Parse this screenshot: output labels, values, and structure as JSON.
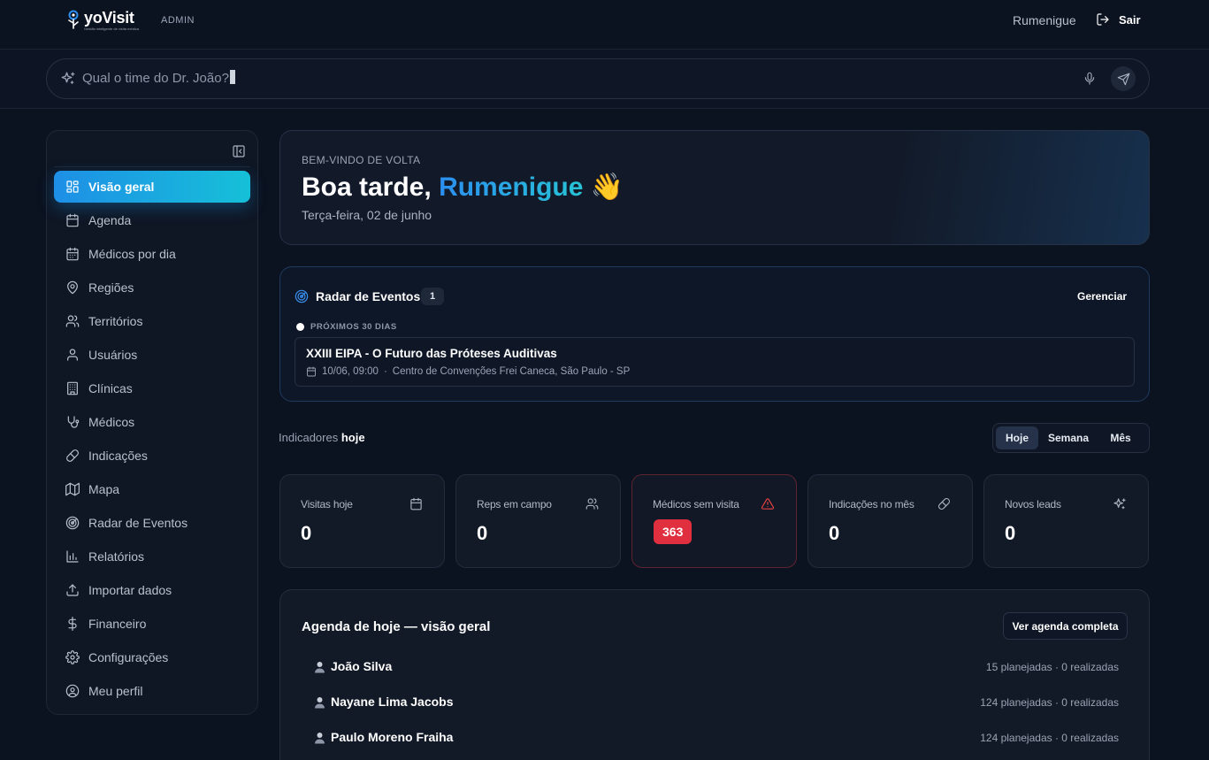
{
  "header": {
    "brand": "yoVisit",
    "tagline": "Gestão inteligente de visita médica",
    "role_badge": "ADMIN",
    "user_name": "Rumenigue",
    "logout_label": "Sair"
  },
  "search": {
    "placeholder": "Qual o time do Dr. João?"
  },
  "sidebar": {
    "items": [
      {
        "label": "Visão geral",
        "icon": "dashboard-icon",
        "active": true
      },
      {
        "label": "Agenda",
        "icon": "calendar-icon"
      },
      {
        "label": "Médicos por dia",
        "icon": "calendar-days-icon"
      },
      {
        "label": "Regiões",
        "icon": "map-pin-icon"
      },
      {
        "label": "Territórios",
        "icon": "users-icon"
      },
      {
        "label": "Usuários",
        "icon": "user-icon"
      },
      {
        "label": "Clínicas",
        "icon": "building-icon"
      },
      {
        "label": "Médicos",
        "icon": "stethoscope-icon"
      },
      {
        "label": "Indicações",
        "icon": "pill-icon"
      },
      {
        "label": "Mapa",
        "icon": "map-icon"
      },
      {
        "label": "Radar de Eventos",
        "icon": "radar-icon"
      },
      {
        "label": "Relatórios",
        "icon": "bar-chart-icon"
      },
      {
        "label": "Importar dados",
        "icon": "upload-icon"
      },
      {
        "label": "Financeiro",
        "icon": "dollar-icon"
      },
      {
        "label": "Configurações",
        "icon": "gear-icon"
      },
      {
        "label": "Meu perfil",
        "icon": "user-circle-icon"
      }
    ]
  },
  "welcome": {
    "kicker": "BEM-VINDO DE VOLTA",
    "greeting": "Boa tarde,",
    "name": "Rumenigue",
    "emoji": "👋",
    "date": "Terça-feira, 02 de junho"
  },
  "radar": {
    "title": "Radar de Eventos",
    "count": "1",
    "manage_label": "Gerenciar",
    "period_label": "PRÓXIMOS 30 DIAS",
    "events": [
      {
        "name": "XXIII EIPA - O Futuro das Próteses Auditivas",
        "datetime": "10/06, 09:00",
        "separator": "·",
        "location": "Centro de Convenções Frei Caneca, São Paulo - SP"
      }
    ]
  },
  "indicators": {
    "title_prefix": "Indicadores",
    "title_period": "hoje",
    "periods": [
      "Hoje",
      "Semana",
      "Mês"
    ],
    "selected_period": "Hoje",
    "cards": [
      {
        "label": "Visitas hoje",
        "value": "0",
        "icon": "calendar-icon"
      },
      {
        "label": "Reps em campo",
        "value": "0",
        "icon": "users-icon"
      },
      {
        "label": "Médicos sem visita",
        "value": "363",
        "icon": "alert-triangle-icon",
        "alert": true
      },
      {
        "label": "Indicações no mês",
        "value": "0",
        "icon": "pill-icon"
      },
      {
        "label": "Novos leads",
        "value": "0",
        "icon": "sparkles-icon"
      }
    ]
  },
  "agenda": {
    "title": "Agenda de hoje — visão geral",
    "full_label": "Ver agenda completa",
    "rows": [
      {
        "name": "João Silva",
        "stats": "15 planejadas · 0 realizadas"
      },
      {
        "name": "Nayane Lima Jacobs",
        "stats": "124 planejadas · 0 realizadas"
      },
      {
        "name": "Paulo Moreno Fraiha",
        "stats": "124 planejadas · 0 realizadas"
      }
    ]
  },
  "colors": {
    "accent_start": "#1e8fe6",
    "accent_end": "#16c0d8",
    "alert": "#e0303f",
    "background": "#0b1220"
  }
}
